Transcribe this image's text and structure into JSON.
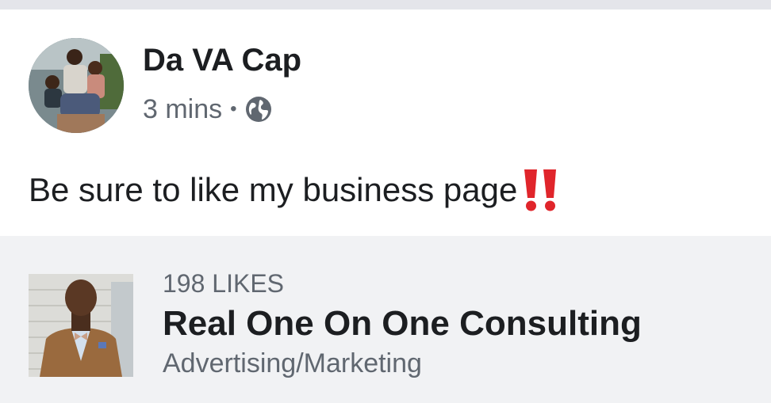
{
  "post": {
    "author": "Da VA Cap",
    "time": "3 mins",
    "separator": "•",
    "privacy_icon": "globe-icon",
    "text": "Be sure to like my business page",
    "emoji": "double-exclamation-icon"
  },
  "page_preview": {
    "likes": "198 LIKES",
    "name": "Real One On One Consulting",
    "category": "Advertising/Marketing"
  },
  "colors": {
    "primary_text": "#1c1e21",
    "secondary_text": "#606770",
    "preview_bg": "#f1f2f4",
    "emoji_red": "#e0252b"
  }
}
